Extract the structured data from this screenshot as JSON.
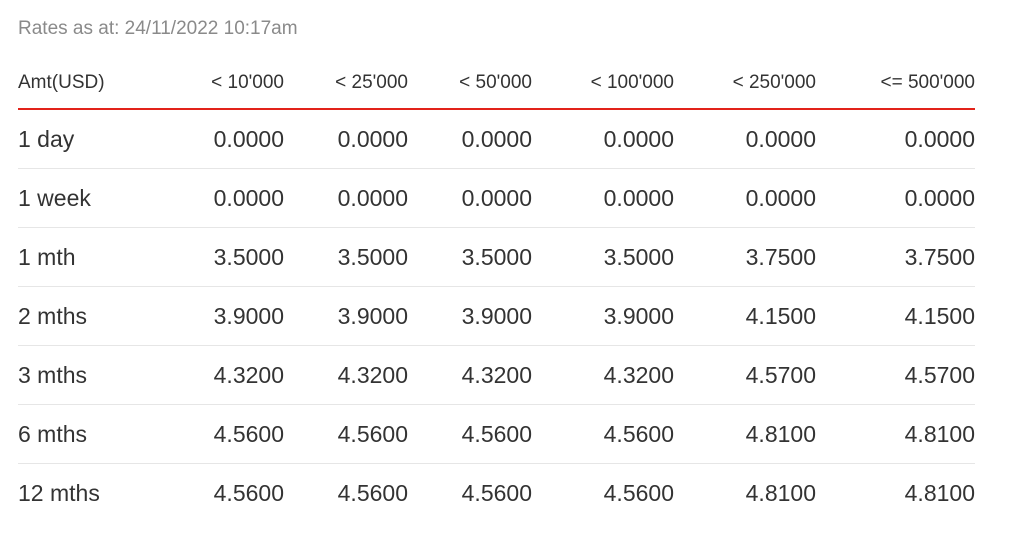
{
  "rates_as_at": "Rates as at: 24/11/2022 10:17am",
  "table": {
    "headers": [
      "Amt(USD)",
      "< 10'000",
      "< 25'000",
      "< 50'000",
      "< 100'000",
      "< 250'000",
      "<= 500'000"
    ],
    "rows": [
      {
        "term": "1 day",
        "values": [
          "0.0000",
          "0.0000",
          "0.0000",
          "0.0000",
          "0.0000",
          "0.0000"
        ]
      },
      {
        "term": "1 week",
        "values": [
          "0.0000",
          "0.0000",
          "0.0000",
          "0.0000",
          "0.0000",
          "0.0000"
        ]
      },
      {
        "term": "1 mth",
        "values": [
          "3.5000",
          "3.5000",
          "3.5000",
          "3.5000",
          "3.7500",
          "3.7500"
        ]
      },
      {
        "term": "2 mths",
        "values": [
          "3.9000",
          "3.9000",
          "3.9000",
          "3.9000",
          "4.1500",
          "4.1500"
        ]
      },
      {
        "term": "3 mths",
        "values": [
          "4.3200",
          "4.3200",
          "4.3200",
          "4.3200",
          "4.5700",
          "4.5700"
        ]
      },
      {
        "term": "6 mths",
        "values": [
          "4.5600",
          "4.5600",
          "4.5600",
          "4.5600",
          "4.8100",
          "4.8100"
        ]
      },
      {
        "term": "12 mths",
        "values": [
          "4.5600",
          "4.5600",
          "4.5600",
          "4.5600",
          "4.8100",
          "4.8100"
        ]
      }
    ]
  },
  "colors": {
    "header_rule": "#e2231a",
    "row_rule": "#e6e6e6",
    "muted_text": "#8a8a8a",
    "text": "#333333"
  }
}
